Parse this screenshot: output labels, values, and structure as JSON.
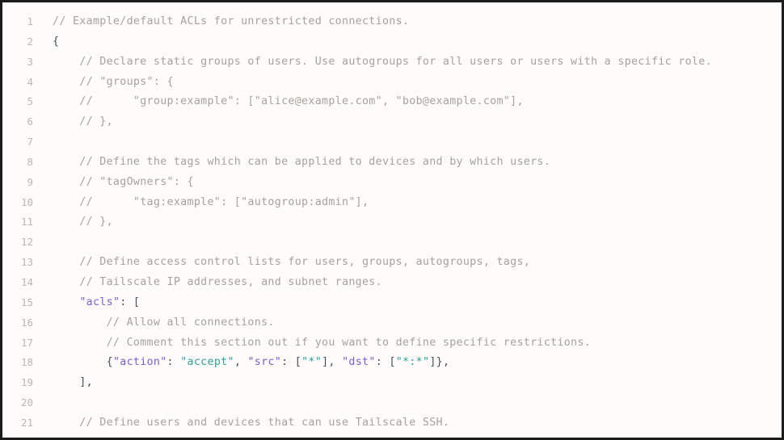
{
  "editor": {
    "name": "acl-json-editor",
    "language": "json-with-comments",
    "background_color": "#fdfcfa",
    "border_color": "#1b1b1b",
    "gutter_color": "#b9b7b4",
    "colors": {
      "comment": "#a6a29c",
      "key": "#7c5ccf",
      "string": "#2fa198",
      "punctuation": "#4a4f5c",
      "plain": "#3f4350"
    },
    "first_visible_line": 1,
    "last_visible_line": 21,
    "total_visible_lines": 21
  },
  "lines": [
    {
      "number": "1",
      "tokens": [
        {
          "t": "comment",
          "v": "// Example/default ACLs for unrestricted connections."
        }
      ]
    },
    {
      "number": "2",
      "tokens": [
        {
          "t": "punct",
          "v": "{"
        }
      ]
    },
    {
      "number": "3",
      "tokens": [
        {
          "t": "comment",
          "v": "    // Declare static groups of users. Use autogroups for all users or users with a specific role."
        }
      ]
    },
    {
      "number": "4",
      "tokens": [
        {
          "t": "comment",
          "v": "    // \"groups\": {"
        }
      ]
    },
    {
      "number": "5",
      "tokens": [
        {
          "t": "comment",
          "v": "    //      \"group:example\": [\"alice@example.com\", \"bob@example.com\"],"
        }
      ]
    },
    {
      "number": "6",
      "tokens": [
        {
          "t": "comment",
          "v": "    // },"
        }
      ]
    },
    {
      "number": "7",
      "tokens": [
        {
          "t": "plain",
          "v": ""
        }
      ]
    },
    {
      "number": "8",
      "tokens": [
        {
          "t": "comment",
          "v": "    // Define the tags which can be applied to devices and by which users."
        }
      ]
    },
    {
      "number": "9",
      "tokens": [
        {
          "t": "comment",
          "v": "    // \"tagOwners\": {"
        }
      ]
    },
    {
      "number": "10",
      "tokens": [
        {
          "t": "comment",
          "v": "    //      \"tag:example\": [\"autogroup:admin\"],"
        }
      ]
    },
    {
      "number": "11",
      "tokens": [
        {
          "t": "comment",
          "v": "    // },"
        }
      ]
    },
    {
      "number": "12",
      "tokens": [
        {
          "t": "plain",
          "v": ""
        }
      ]
    },
    {
      "number": "13",
      "tokens": [
        {
          "t": "comment",
          "v": "    // Define access control lists for users, groups, autogroups, tags,"
        }
      ]
    },
    {
      "number": "14",
      "tokens": [
        {
          "t": "comment",
          "v": "    // Tailscale IP addresses, and subnet ranges."
        }
      ]
    },
    {
      "number": "15",
      "tokens": [
        {
          "t": "plain",
          "v": "    "
        },
        {
          "t": "key",
          "v": "\"acls\""
        },
        {
          "t": "punct",
          "v": ": ["
        }
      ]
    },
    {
      "number": "16",
      "tokens": [
        {
          "t": "comment",
          "v": "        // Allow all connections."
        }
      ]
    },
    {
      "number": "17",
      "tokens": [
        {
          "t": "comment",
          "v": "        // Comment this section out if you want to define specific restrictions."
        }
      ]
    },
    {
      "number": "18",
      "tokens": [
        {
          "t": "plain",
          "v": "        "
        },
        {
          "t": "punct",
          "v": "{"
        },
        {
          "t": "key",
          "v": "\"action\""
        },
        {
          "t": "punct",
          "v": ": "
        },
        {
          "t": "string",
          "v": "\"accept\""
        },
        {
          "t": "punct",
          "v": ", "
        },
        {
          "t": "key",
          "v": "\"src\""
        },
        {
          "t": "punct",
          "v": ": ["
        },
        {
          "t": "string",
          "v": "\"*\""
        },
        {
          "t": "punct",
          "v": "], "
        },
        {
          "t": "key",
          "v": "\"dst\""
        },
        {
          "t": "punct",
          "v": ": ["
        },
        {
          "t": "string",
          "v": "\"*:*\""
        },
        {
          "t": "punct",
          "v": "]},"
        }
      ]
    },
    {
      "number": "19",
      "tokens": [
        {
          "t": "punct",
          "v": "    ],"
        }
      ]
    },
    {
      "number": "20",
      "tokens": [
        {
          "t": "plain",
          "v": ""
        }
      ]
    },
    {
      "number": "21",
      "tokens": [
        {
          "t": "comment",
          "v": "    // Define users and devices that can use Tailscale SSH."
        }
      ]
    }
  ]
}
